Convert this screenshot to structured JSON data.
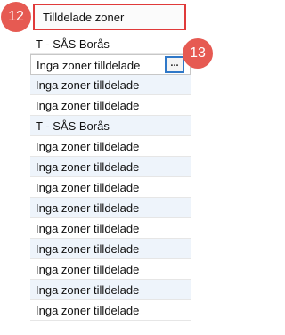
{
  "header": {
    "label": "Tilldelade zoner"
  },
  "rows": [
    {
      "text": "T - SÅS Borås"
    },
    {
      "text": "Inga zoner tilldelade"
    },
    {
      "text": "Inga zoner tilldelade"
    },
    {
      "text": "Inga zoner tilldelade"
    },
    {
      "text": "T - SÅS Borås"
    },
    {
      "text": "Inga zoner tilldelade"
    },
    {
      "text": "Inga zoner tilldelade"
    },
    {
      "text": "Inga zoner tilldelade"
    },
    {
      "text": "Inga zoner tilldelade"
    },
    {
      "text": "Inga zoner tilldelade"
    },
    {
      "text": "Inga zoner tilldelade"
    },
    {
      "text": "Inga zoner tilldelade"
    },
    {
      "text": "Inga zoner tilldelade"
    },
    {
      "text": "Inga zoner tilldelade"
    }
  ],
  "ellipsis_button": {
    "label": "..."
  },
  "callouts": {
    "header": "12",
    "button": "13"
  },
  "colors": {
    "callout": "#e65a52",
    "header_border": "#e03a3a",
    "button_border": "#2f78c8",
    "alt_row": "#eef4fb"
  }
}
